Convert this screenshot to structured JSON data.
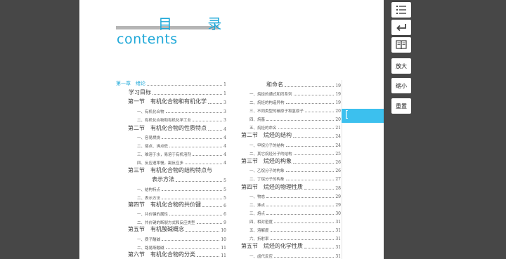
{
  "header": {
    "title_cn": "目 录",
    "title_en": "contents"
  },
  "toolbar": {
    "icons": [
      "list-icon",
      "back-icon",
      "book-icon"
    ],
    "zoom_in_label": "放大",
    "zoom_out_label": "缩小",
    "reset_label": "重置"
  },
  "side_tab": {
    "label": "["
  },
  "colors": {
    "accent": "#1fa8d8",
    "tab": "#3cc0ee",
    "background": "#474747"
  },
  "toc_left": [
    {
      "text": "第一章　绪论",
      "page": "1",
      "level": "h"
    },
    {
      "text": "学习目标",
      "page": "1",
      "level": "1"
    },
    {
      "text": "第一节　有机化合物和有机化学",
      "page": "3",
      "level": "1"
    },
    {
      "text": "一、有机化合物",
      "page": "3",
      "level": "2"
    },
    {
      "text": "二、有机化合物和有机化学工业",
      "page": "3",
      "level": "2"
    },
    {
      "text": "第二节　有机化合物的性质特点",
      "page": "4",
      "level": "1"
    },
    {
      "text": "一、容易燃烧",
      "page": "4",
      "level": "2"
    },
    {
      "text": "二、熔点、沸点低",
      "page": "4",
      "level": "2"
    },
    {
      "text": "三、难溶于水，易溶于有机溶剂",
      "page": "4",
      "level": "2"
    },
    {
      "text": "四、反应速率慢，副反应多",
      "page": "4",
      "level": "2"
    },
    {
      "text": "第三节　有机化合物的结构特点与",
      "page": "",
      "level": "1"
    },
    {
      "text": "表示方法",
      "page": "5",
      "level": "c"
    },
    {
      "text": "一、结构特点",
      "page": "5",
      "level": "2"
    },
    {
      "text": "二、表示方法",
      "page": "5",
      "level": "2"
    },
    {
      "text": "第四节　有机化合物的共价键",
      "page": "6",
      "level": "1"
    },
    {
      "text": "一、共价键的属性",
      "page": "6",
      "level": "2"
    },
    {
      "text": "二、共价键的断裂方式和反应类型",
      "page": "9",
      "level": "2"
    },
    {
      "text": "第五节　有机酸碱概念",
      "page": "10",
      "level": "1"
    },
    {
      "text": "一、质子酸碱",
      "page": "10",
      "level": "2"
    },
    {
      "text": "二、路易斯酸碱",
      "page": "11",
      "level": "2"
    },
    {
      "text": "第六节　有机化合物的分类",
      "page": "11",
      "level": "1"
    }
  ],
  "toc_right": [
    {
      "text": "和命名",
      "page": "19",
      "level": "c"
    },
    {
      "text": "一、烷烃的通式和同系列",
      "page": "19",
      "level": "2"
    },
    {
      "text": "二、烷烃的构造异构",
      "page": "19",
      "level": "2"
    },
    {
      "text": "三、不同类型的碳原子和氢原子",
      "page": "20",
      "level": "2"
    },
    {
      "text": "四、烷基",
      "page": "20",
      "level": "2"
    },
    {
      "text": "五、烷烃的命名",
      "page": "21",
      "level": "2"
    },
    {
      "text": "第二节　烷烃的结构",
      "page": "24",
      "level": "1"
    },
    {
      "text": "一、甲烷分子的结构",
      "page": "24",
      "level": "2"
    },
    {
      "text": "二、其它烷烃分子的结构",
      "page": "25",
      "level": "2"
    },
    {
      "text": "第三节　烷烃的构象",
      "page": "26",
      "level": "1"
    },
    {
      "text": "一、乙烷分子的构象",
      "page": "26",
      "level": "2"
    },
    {
      "text": "二、丁烷分子的构象",
      "page": "27",
      "level": "2"
    },
    {
      "text": "第四节　烷烃的物理性质",
      "page": "28",
      "level": "1"
    },
    {
      "text": "一、物态",
      "page": "29",
      "level": "2"
    },
    {
      "text": "二、沸点",
      "page": "29",
      "level": "2"
    },
    {
      "text": "三、熔点",
      "page": "30",
      "level": "2"
    },
    {
      "text": "四、相对密度",
      "page": "31",
      "level": "2"
    },
    {
      "text": "五、溶解度",
      "page": "31",
      "level": "2"
    },
    {
      "text": "六、折射率",
      "page": "31",
      "level": "2"
    },
    {
      "text": "第五节　烷烃的化学性质",
      "page": "31",
      "level": "1"
    },
    {
      "text": "一、卤代反应",
      "page": "31",
      "level": "2"
    }
  ]
}
